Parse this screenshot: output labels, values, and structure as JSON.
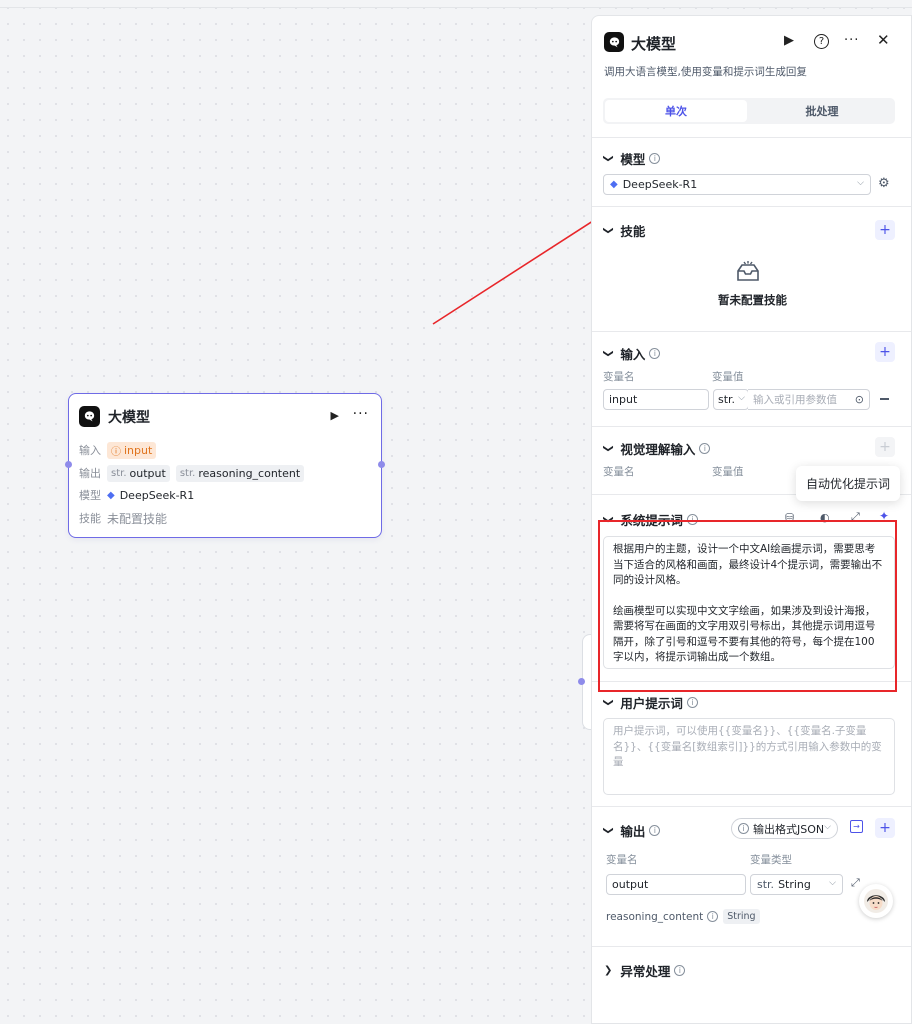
{
  "node": {
    "title": "大模型",
    "run_icon": "play-icon",
    "more_icon": "more-icon",
    "rows": {
      "input_label": "输入",
      "input_var": "input",
      "output_label": "输出",
      "output_type_1": "str.",
      "output_var_1": "output",
      "output_type_2": "str.",
      "output_var_2": "reasoning_content",
      "model_label": "模型",
      "model_value": "DeepSeek-R1",
      "skill_label": "技能",
      "skill_value": "未配置技能"
    }
  },
  "panel": {
    "title": "大模型",
    "description": "调用大语言模型,使用变量和提示词生成回复",
    "tabs": [
      "单次",
      "批处理"
    ],
    "active_tab": "单次",
    "model": {
      "label": "模型",
      "value": "DeepSeek-R1"
    },
    "skills": {
      "label": "技能",
      "empty_text": "暂未配置技能"
    },
    "input": {
      "label": "输入",
      "col_name": "变量名",
      "col_value": "变量值",
      "var_name": "input",
      "type": "str.",
      "value_placeholder": "输入或引用参数值"
    },
    "vision_input": {
      "label": "视觉理解输入",
      "col_name": "变量名",
      "col_value": "变量值"
    },
    "system_prompt": {
      "label": "系统提示词",
      "tooltip": "自动优化提示词",
      "para1": "根据用户的主题，设计一个中文AI绘画提示词，需要思考当下适合的风格和画面，最终设计4个提示词，需要输出不同的设计风格。",
      "para2": "绘画模型可以实现中文文字绘画，如果涉及到设计海报，需要将写在画面的文字用双引号标出，其他提示词用逗号隔开，除了引号和逗号不要有其他的符号，每个提在100字以内，将提示词输出成一个数组。"
    },
    "user_prompt": {
      "label": "用户提示词",
      "placeholder": "用户提示词，可以使用{{变量名}}、{{变量名.子变量名}}、{{变量名[数组索引]}}的方式引用输入参数中的变量"
    },
    "output": {
      "label": "输出",
      "format_label": "输出格式JSON",
      "col_name": "变量名",
      "col_type": "变量类型",
      "var_name": "output",
      "type_prefix": "str.",
      "type_value": "String",
      "extra_var": "reasoning_content",
      "extra_type": "String"
    },
    "exception": {
      "label": "异常处理"
    }
  },
  "colors": {
    "accent": "#4d53e8",
    "node_border": "#6f6be6",
    "annotation_red": "#e8262a",
    "warn": "#e0741d"
  }
}
